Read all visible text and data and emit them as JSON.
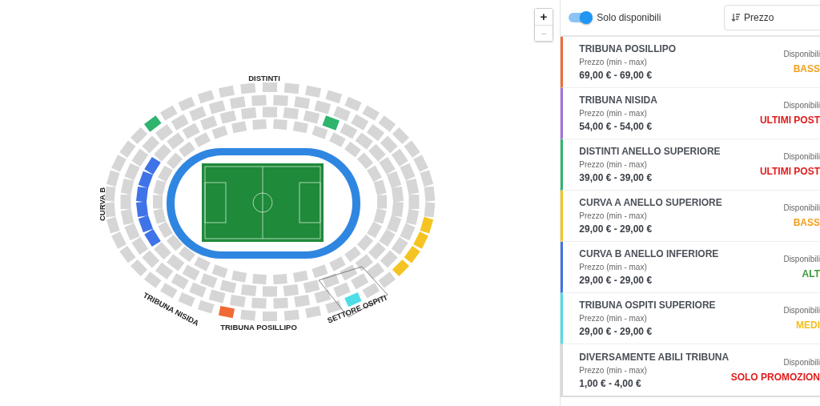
{
  "map": {
    "zoom_in": "+",
    "zoom_out": "−",
    "labels": [
      {
        "text": "DISTINTI",
        "kind": "top"
      },
      {
        "text": "CURVA B",
        "kind": "left"
      },
      {
        "text": "TRIBUNA NISIDA",
        "kind": "bottom-left"
      },
      {
        "text": "TRIBUNA POSILLIPO",
        "kind": "bottom"
      },
      {
        "text": "SETTORE OSPITI",
        "kind": "bottom-right"
      }
    ]
  },
  "filters": {
    "available_only": {
      "label": "Solo disponibili",
      "on": true
    },
    "sort": {
      "value": "Prezzo"
    }
  },
  "sectors": [
    {
      "name": "TRIBUNA POSILLIPO",
      "price_label": "Prezzo (min - max)",
      "price": "69,00 € - 69,00 €",
      "availability_label": "Disponibili",
      "availability": {
        "text": "BASS",
        "color": "#f0a020"
      },
      "color": "#f06a35"
    },
    {
      "name": "TRIBUNA NISIDA",
      "price_label": "Prezzo (min - max)",
      "price": "54,00 € - 54,00 €",
      "availability_label": "Disponibili",
      "availability": {
        "text": "ULTIMI POST",
        "color": "#e01b1b"
      },
      "color": "#a46fe0"
    },
    {
      "name": "DISTINTI ANELLO SUPERIORE",
      "price_label": "Prezzo (min - max)",
      "price": "39,00 € - 39,00 €",
      "availability_label": "Disponibili",
      "availability": {
        "text": "ULTIMI POST",
        "color": "#e01b1b"
      },
      "color": "#2fb46e"
    },
    {
      "name": "CURVA A ANELLO SUPERIORE",
      "price_label": "Prezzo (min - max)",
      "price": "29,00 € - 29,00 €",
      "availability_label": "Disponibili",
      "availability": {
        "text": "BASS",
        "color": "#f0a020"
      },
      "color": "#f5c423"
    },
    {
      "name": "CURVA B ANELLO INFERIORE",
      "price_label": "Prezzo (min - max)",
      "price": "29,00 € - 29,00 €",
      "availability_label": "Disponibili",
      "availability": {
        "text": "ALT",
        "color": "#3a9a3a"
      },
      "color": "#3f73e8"
    },
    {
      "name": "TRIBUNA OSPITI SUPERIORE",
      "price_label": "Prezzo (min - max)",
      "price": "29,00 € - 29,00 €",
      "availability_label": "Disponibili",
      "availability": {
        "text": "MEDI",
        "color": "#f2bf1c"
      },
      "color": "#4fdde8"
    },
    {
      "name": "DIVERSAMENTE ABILI TRIBUNA",
      "price_label": "Prezzo (min - max)",
      "price": "1,00 € - 4,00 €",
      "availability_label": "Disponibili",
      "availability": {
        "text": "SOLO PROMOZION",
        "color": "#e01b1b"
      },
      "color": "#d9d9d9"
    }
  ]
}
